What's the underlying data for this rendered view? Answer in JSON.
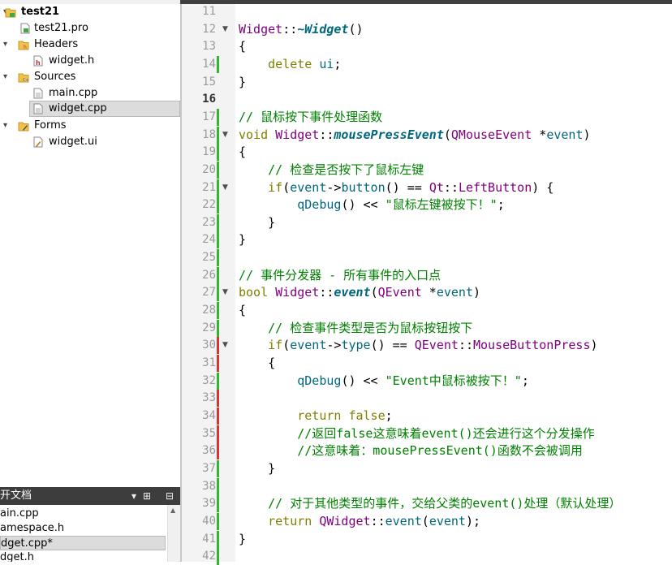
{
  "tree": {
    "project": "test21",
    "items": [
      {
        "label": "test21.pro",
        "icon": "pro-file-icon"
      },
      {
        "label": "Headers",
        "icon": "headers-folder-icon"
      },
      {
        "label": "widget.h",
        "icon": "header-file-icon"
      },
      {
        "label": "Sources",
        "icon": "sources-folder-icon"
      },
      {
        "label": "main.cpp",
        "icon": "cpp-file-icon"
      },
      {
        "label": "widget.cpp",
        "icon": "cpp-file-icon",
        "selected": true
      },
      {
        "label": "Forms",
        "icon": "forms-folder-icon"
      },
      {
        "label": "widget.ui",
        "icon": "ui-file-icon"
      }
    ]
  },
  "open_docs": {
    "title": "开文档",
    "items": [
      "ain.cpp",
      "amespace.h",
      "dget.cpp*",
      "dget.h"
    ],
    "selected_index": 2
  },
  "editor": {
    "current_line": 16,
    "lines": [
      {
        "n": "11",
        "text": ""
      },
      {
        "n": "12",
        "text": "Widget::~Widget()"
      },
      {
        "n": "13",
        "text": "{"
      },
      {
        "n": "14",
        "text": "    delete ui;"
      },
      {
        "n": "15",
        "text": "}"
      },
      {
        "n": "16",
        "text": ""
      },
      {
        "n": "17",
        "text": "// 鼠标按下事件处理函数"
      },
      {
        "n": "18",
        "text": "void Widget::mousePressEvent(QMouseEvent *event)"
      },
      {
        "n": "19",
        "text": "{"
      },
      {
        "n": "20",
        "text": "    // 检查是否按下了鼠标左键"
      },
      {
        "n": "21",
        "text": "    if(event->button() == Qt::LeftButton) {"
      },
      {
        "n": "22",
        "text": "        qDebug() << \"鼠标左键被按下！\";"
      },
      {
        "n": "23",
        "text": "    }"
      },
      {
        "n": "24",
        "text": "}"
      },
      {
        "n": "25",
        "text": ""
      },
      {
        "n": "26",
        "text": "// 事件分发器 - 所有事件的入口点"
      },
      {
        "n": "27",
        "text": "bool Widget::event(QEvent *event)"
      },
      {
        "n": "28",
        "text": "{"
      },
      {
        "n": "29",
        "text": "    // 检查事件类型是否为鼠标按钮按下"
      },
      {
        "n": "30",
        "text": "    if(event->type() == QEvent::MouseButtonPress)"
      },
      {
        "n": "31",
        "text": "    {"
      },
      {
        "n": "32",
        "text": "        qDebug() << \"Event中鼠标被按下！\";"
      },
      {
        "n": "33",
        "text": ""
      },
      {
        "n": "34",
        "text": "        return false;"
      },
      {
        "n": "35",
        "text": "        //返回false这意味着event()还会进行这个分发操作"
      },
      {
        "n": "36",
        "text": "        //这意味着：mousePressEvent()函数不会被调用"
      },
      {
        "n": "37",
        "text": "    }"
      },
      {
        "n": "38",
        "text": ""
      },
      {
        "n": "39",
        "text": "    // 对于其他类型的事件，交给父类的event()处理（默认处理）"
      },
      {
        "n": "40",
        "text": "    return QWidget::event(event);"
      },
      {
        "n": "41",
        "text": "}"
      },
      {
        "n": "42",
        "text": ""
      }
    ]
  },
  "colors": {
    "keyword": "#808000",
    "class": "#800080",
    "function": "#00677c",
    "comment": "#008000",
    "added_marker": "#2eb82e",
    "modified_marker": "#e03030"
  }
}
